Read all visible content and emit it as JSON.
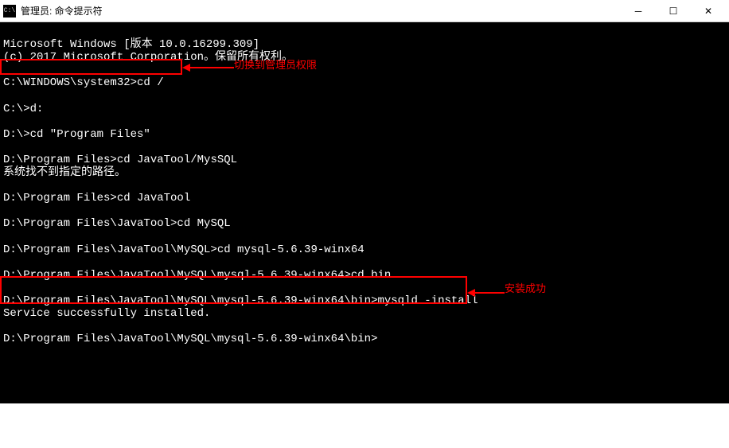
{
  "window": {
    "icon_text": "C:\\",
    "title": "管理员: 命令提示符"
  },
  "terminal": {
    "version_line": "Microsoft Windows [版本 10.0.16299.309]",
    "copyright_line": "(c) 2017 Microsoft Corporation。保留所有权利。",
    "lines": [
      "C:\\WINDOWS\\system32>cd /",
      "C:\\>d:",
      "D:\\>cd \"Program Files\"",
      "D:\\Program Files>cd JavaTool/MysSQL",
      "系统找不到指定的路径。",
      "D:\\Program Files>cd JavaTool",
      "D:\\Program Files\\JavaTool>cd MySQL",
      "D:\\Program Files\\JavaTool\\MySQL>cd mysql-5.6.39-winx64",
      "D:\\Program Files\\JavaTool\\MySQL\\mysql-5.6.39-winx64>cd bin",
      "D:\\Program Files\\JavaTool\\MySQL\\mysql-5.6.39-winx64\\bin>mysqld -install",
      "Service successfully installed.",
      "D:\\Program Files\\JavaTool\\MySQL\\mysql-5.6.39-winx64\\bin>"
    ]
  },
  "annotations": {
    "admin_switch": "切换到管理员权限",
    "install_success": "安装成功"
  }
}
